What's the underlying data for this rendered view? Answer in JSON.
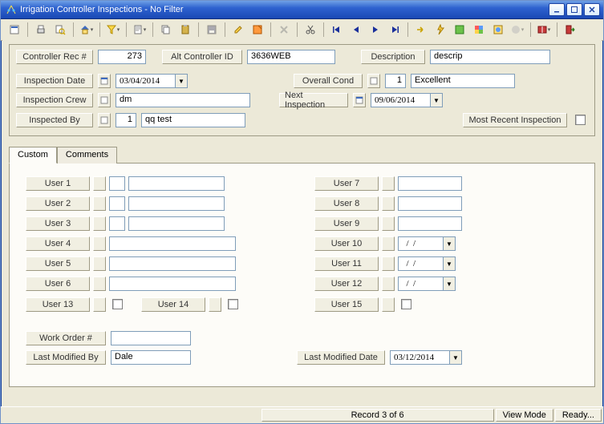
{
  "window_title": "Irrigation Controller Inspections - No Filter",
  "toolbar_icons": [
    "form-icon",
    "print-icon",
    "print-preview-icon",
    "home-dropdown-icon",
    "filter-funnel-icon",
    "doc-dropdown-icon",
    "copy-icon",
    "paste-icon",
    "save-icon",
    "edit-pencil-icon",
    "notes-icon",
    "delete-x-icon",
    "cut-scissors-icon",
    "nav-first-icon",
    "nav-prev-icon",
    "nav-next-icon",
    "nav-last-icon",
    "goto-arrow-icon",
    "refresh-bolt-icon",
    "module-green-icon",
    "module-multi-icon",
    "world-icon",
    "globe-dim-icon",
    "help-book-icon",
    "exit-door-icon"
  ],
  "top": {
    "controller_rec_label": "Controller Rec #",
    "controller_rec_value": "273",
    "alt_controller_label": "Alt Controller ID",
    "alt_controller_value": "3636WEB",
    "description_label": "Description",
    "description_value": "descrip",
    "inspection_date_label": "Inspection Date",
    "inspection_date_value": "03/04/2014",
    "overall_cond_label": "Overall Cond",
    "overall_cond_num": "1",
    "overall_cond_text": "Excellent",
    "inspection_crew_label": "Inspection Crew",
    "inspection_crew_value": "dm",
    "next_inspection_label": "Next Inspection",
    "next_inspection_value": "09/06/2014",
    "inspected_by_label": "Inspected By",
    "inspected_by_num": "1",
    "inspected_by_name": "qq test",
    "most_recent_label": "Most Recent Inspection"
  },
  "tabs": {
    "custom": "Custom",
    "comments": "Comments"
  },
  "users": {
    "u1": "User 1",
    "u2": "User 2",
    "u3": "User 3",
    "u4": "User 4",
    "u5": "User 5",
    "u6": "User 6",
    "u7": "User 7",
    "u8": "User 8",
    "u9": "User 9",
    "u10": "User 10",
    "u11": "User 11",
    "u12": "User 12",
    "u13": "User 13",
    "u14": "User 14",
    "u15": "User 15",
    "date_placeholder": "  /  /"
  },
  "bottom": {
    "work_order_label": "Work Order #",
    "last_modified_by_label": "Last Modified By",
    "last_modified_by_value": "Dale",
    "last_modified_date_label": "Last Modified Date",
    "last_modified_date_value": "03/12/2014"
  },
  "status": {
    "record": "Record 3 of 6",
    "viewmode": "View Mode",
    "ready": "Ready..."
  }
}
